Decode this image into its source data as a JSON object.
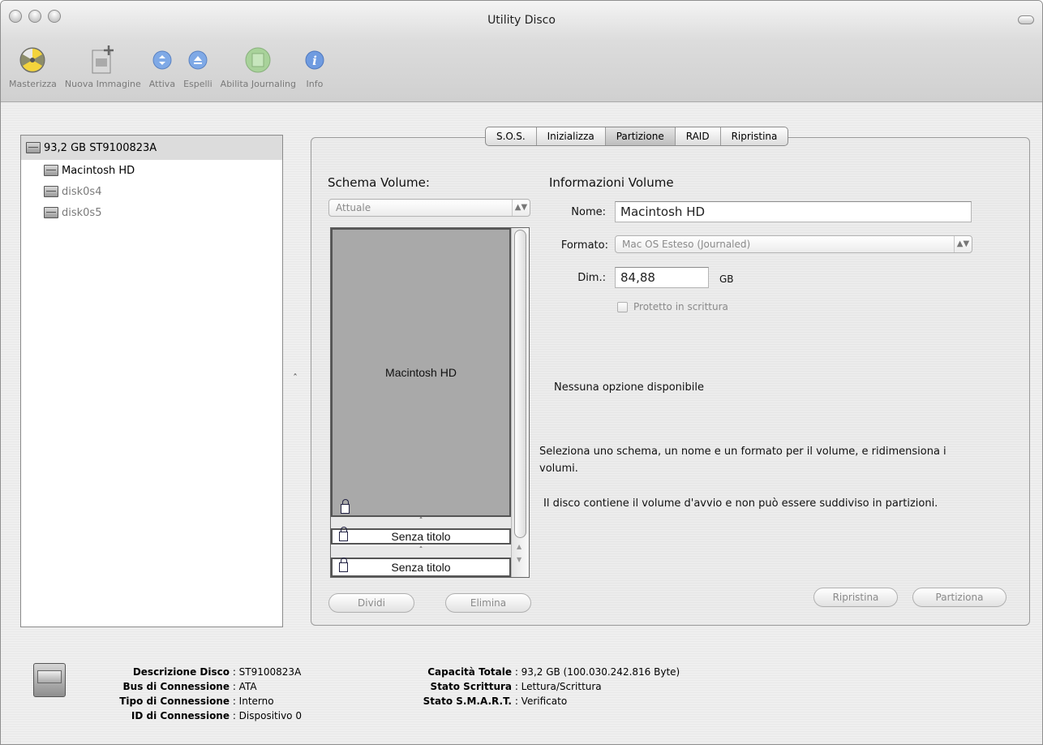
{
  "window": {
    "title": "Utility Disco"
  },
  "toolbar": {
    "items": [
      {
        "label": "Masterizza",
        "icon": "burn-icon"
      },
      {
        "label": "Nuova Immagine",
        "icon": "new-image-icon"
      },
      {
        "label": "Attiva",
        "icon": "mount-icon"
      },
      {
        "label": "Espelli",
        "icon": "eject-icon"
      },
      {
        "label": "Abilita Journaling",
        "icon": "journaling-icon"
      },
      {
        "label": "Info",
        "icon": "info-icon"
      }
    ]
  },
  "sidebar": {
    "items": [
      {
        "label": "93,2 GB ST9100823A"
      },
      {
        "label": "Macintosh HD"
      },
      {
        "label": "disk0s4"
      },
      {
        "label": "disk0s5"
      }
    ]
  },
  "tabs": [
    {
      "label": "S.O.S."
    },
    {
      "label": "Inizializza"
    },
    {
      "label": "Partizione"
    },
    {
      "label": "RAID"
    },
    {
      "label": "Ripristina"
    }
  ],
  "scheme": {
    "heading": "Schema Volume:",
    "select_value": "Attuale",
    "volumes": [
      "Macintosh HD",
      "Senza titolo",
      "Senza titolo"
    ],
    "split_button": "Dividi",
    "delete_button": "Elimina"
  },
  "volume_info": {
    "heading": "Informazioni Volume",
    "name_label": "Nome:",
    "name_value": "Macintosh HD",
    "format_label": "Formato:",
    "format_value": "Mac OS Esteso (Journaled)",
    "size_label": "Dim.:",
    "size_value": "84,88",
    "size_unit": "GB",
    "write_protect_label": "Protetto in scrittura",
    "no_options": "Nessuna opzione disponibile",
    "help_1": "Seleziona uno schema, un nome e un formato per il volume, e ridimensiona i volumi.",
    "help_2": "Il disco contiene il volume d'avvio e non può essere suddiviso in partizioni.",
    "revert_button": "Ripristina",
    "partition_button": "Partiziona"
  },
  "footer": {
    "left": [
      {
        "label": "Descrizione Disco",
        "value": "ST9100823A"
      },
      {
        "label": "Bus di Connessione",
        "value": "ATA"
      },
      {
        "label": "Tipo di Connessione",
        "value": "Interno"
      },
      {
        "label": "ID di Connessione",
        "value": "Dispositivo 0"
      }
    ],
    "right": [
      {
        "label": "Capacità Totale",
        "value": "93,2 GB (100.030.242.816 Byte)"
      },
      {
        "label": "Stato Scrittura",
        "value": "Lettura/Scrittura"
      },
      {
        "label": "Stato S.M.A.R.T.",
        "value": "Verificato"
      }
    ]
  }
}
